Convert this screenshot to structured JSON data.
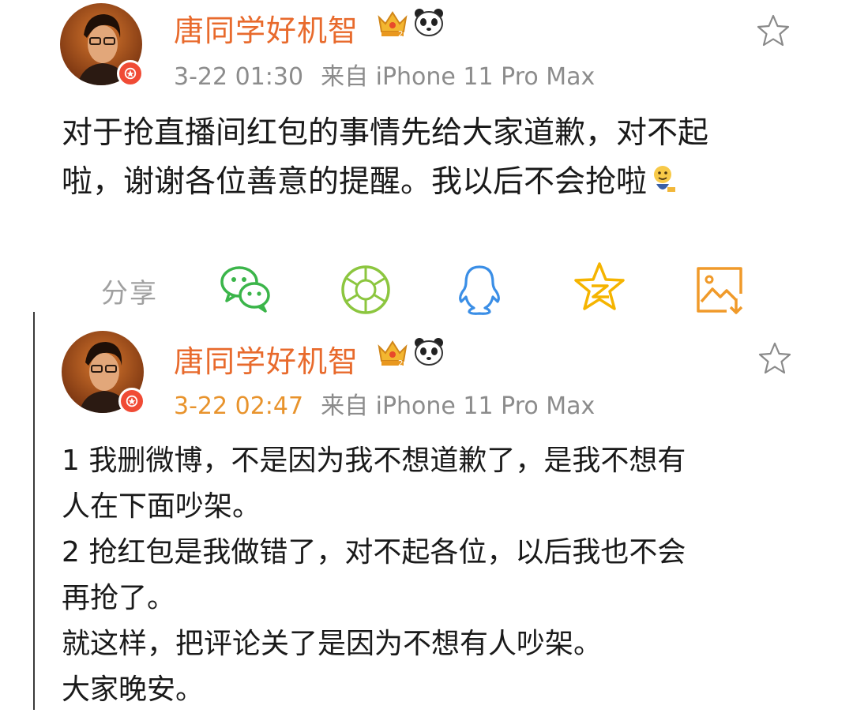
{
  "posts": [
    {
      "username": "唐同学好机智",
      "time": "3-22 01:30",
      "source": "来自 iPhone 11 Pro Max",
      "content": "对于抢直播间红包的事情先给大家道歉，对不起\n啦，谢谢各位善意的提醒。我以后不会抢啦"
    },
    {
      "username": "唐同学好机智",
      "time": "3-22 02:47",
      "source": "来自 iPhone 11 Pro Max",
      "content": "1 我删微博，不是因为我不想道歉了，是我不想有\n人在下面吵架。\n2 抢红包是我做错了，对不起各位，以后我也不会\n再抢了。\n就这样，把评论关了是因为不想有人吵架。\n大家晚安。"
    }
  ],
  "share": {
    "label": "分享",
    "targets": [
      "wechat-icon",
      "moments-icon",
      "qq-icon",
      "qzone-icon",
      "save-image-icon"
    ]
  },
  "colors": {
    "username": "#e86a2c",
    "time_highlight": "#e8932c",
    "meta": "#8c8c8c",
    "verify_badge": "#f04b35",
    "wechat": "#3bb54a",
    "moments": "#8cc63f",
    "qq": "#3a8ee6",
    "qzone": "#f5b400",
    "save": "#f09a2a"
  }
}
